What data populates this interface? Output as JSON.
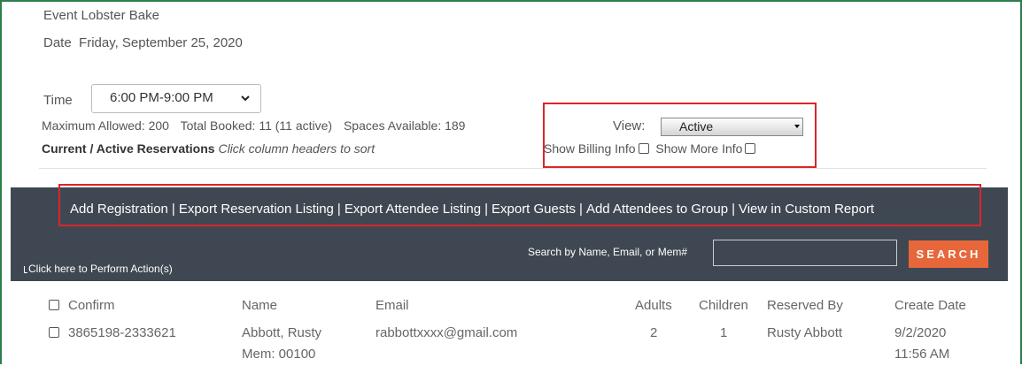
{
  "event": {
    "label": "Event",
    "value": "Lobster Bake"
  },
  "date": {
    "label": "Date",
    "value": "Friday, September 25, 2020"
  },
  "time": {
    "label": "Time",
    "value": "6:00 PM-9:00 PM"
  },
  "stats": {
    "max": "Maximum Allowed: 200",
    "booked": "Total Booked: 11 (11 active)",
    "spaces": "Spaces Available: 189"
  },
  "current": {
    "bold": "Current / Active Reservations",
    "hint": "Click column headers to sort"
  },
  "view": {
    "label": "View:",
    "value": "Active"
  },
  "options": {
    "billing": "Show Billing Info",
    "more": "Show More Info"
  },
  "actions": [
    "Add Registration",
    "Export Reservation Listing",
    "Export Attendee Listing",
    "Export Guests",
    "Add Attendees to Group",
    "View in Custom Report"
  ],
  "search": {
    "label": "Search by Name, Email, or Mem#",
    "value": "",
    "button": "SEARCH"
  },
  "perform": "Click here to Perform Action(s)",
  "table": {
    "headers": {
      "confirm": "Confirm",
      "name": "Name",
      "email": "Email",
      "adults": "Adults",
      "children": "Children",
      "reserved_by": "Reserved By",
      "create_date": "Create Date"
    },
    "rows": [
      {
        "confirm": "3865198-2333621",
        "name": "Abbott, Rusty",
        "mem": "Mem: 00100",
        "email": "rabbottxxxx@gmail.com",
        "adults": "2",
        "children": "1",
        "reserved_by": "Rusty Abbott",
        "create_date": "9/2/2020",
        "create_time": "11:56 AM"
      }
    ]
  },
  "colors": {
    "frame": "#2f7d4a",
    "highlight": "#d9262c",
    "band": "#3f4852",
    "search_button": "#e8673a"
  }
}
